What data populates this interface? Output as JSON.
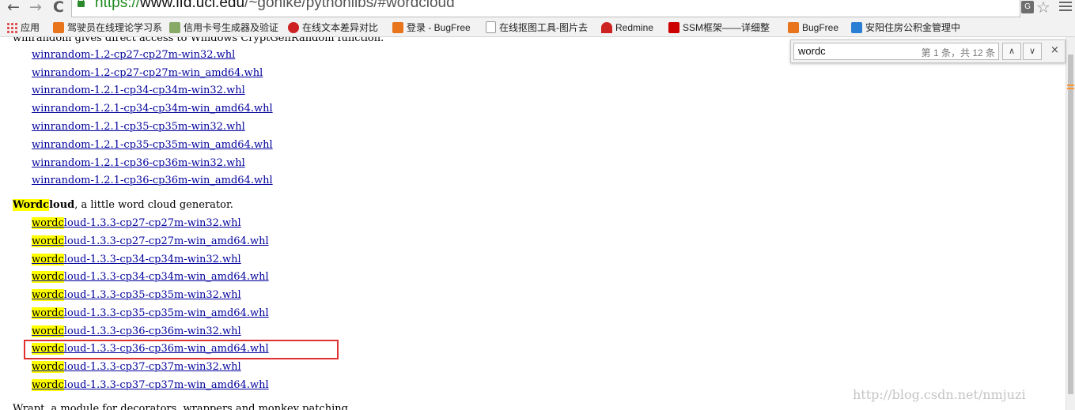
{
  "browser": {
    "url_scheme": "https://",
    "url_host": "www.lfd.uci.edu",
    "url_path": "/~gohlke/pythonlibs/#wordcloud",
    "back_glyph": "←",
    "forward_glyph": "→",
    "reload_glyph": "C",
    "star_glyph": "☆",
    "translate_glyph": "G"
  },
  "bookmarks": [
    {
      "label": "应用",
      "icon": "apps-icon",
      "color": "#d44"
    },
    {
      "label": "驾驶员在线理论学习系",
      "icon": "favicon-icon",
      "color": "#e8741c"
    },
    {
      "label": "信用卡号生成器及验证",
      "icon": "pen-icon",
      "color": "#7a6"
    },
    {
      "label": "在线文本差异对比",
      "icon": "favicon-icon",
      "color": "#c22"
    },
    {
      "label": "登录 - BugFree",
      "icon": "favicon-icon",
      "color": "#e8741c"
    },
    {
      "label": "在线抠图工具-图片去",
      "icon": "page-icon",
      "color": "#999"
    },
    {
      "label": "Redmine",
      "icon": "favicon-icon",
      "color": "#c22"
    },
    {
      "label": "SSM框架——详细整",
      "icon": "favicon-icon",
      "color": "#c00"
    },
    {
      "label": "BugFree",
      "icon": "favicon-icon",
      "color": "#e8741c"
    },
    {
      "label": "安阳住房公积金管理中",
      "icon": "favicon-icon",
      "color": "#2a7fd4"
    }
  ],
  "find": {
    "query": "wordc",
    "count": "第 1 条，共 12 条",
    "prev_glyph": "∧",
    "next_glyph": "∨",
    "close_glyph": "×"
  },
  "page": {
    "cut_line": "winrandom gives direct access to Windows CryptGenRandom function.",
    "winrandom_links": [
      "winrandom‑1.2‑cp27‑cp27m‑win32.whl",
      "winrandom‑1.2‑cp27‑cp27m‑win_amd64.whl",
      "winrandom‑1.2.1‑cp34‑cp34m‑win32.whl",
      "winrandom‑1.2.1‑cp34‑cp34m‑win_amd64.whl",
      "winrandom‑1.2.1‑cp35‑cp35m‑win32.whl",
      "winrandom‑1.2.1‑cp35‑cp35m‑win_amd64.whl",
      "winrandom‑1.2.1‑cp36‑cp36m‑win32.whl",
      "winrandom‑1.2.1‑cp36‑cp36m‑win_amd64.whl"
    ],
    "wordcloud": {
      "name_highlight": "Wordc",
      "name_rest": "loud",
      "description": ", a little word cloud generator.",
      "link_highlight": "wordc",
      "link_rests": [
        "loud‑1.3.3‑cp27‑cp27m‑win32.whl",
        "loud‑1.3.3‑cp27‑cp27m‑win_amd64.whl",
        "loud‑1.3.3‑cp34‑cp34m‑win32.whl",
        "loud‑1.3.3‑cp34‑cp34m‑win_amd64.whl",
        "loud‑1.3.3‑cp35‑cp35m‑win32.whl",
        "loud‑1.3.3‑cp35‑cp35m‑win_amd64.whl",
        "loud‑1.3.3‑cp36‑cp36m‑win32.whl",
        "loud‑1.3.3‑cp36‑cp36m‑win_amd64.whl",
        "loud‑1.3.3‑cp37‑cp37m‑win32.whl",
        "loud‑1.3.3‑cp37‑cp37m‑win_amd64.whl"
      ]
    },
    "next_cut_line": "Wrapt, a module for decorators, wrappers and monkey patching.",
    "watermark": "http://blog.csdn.net/nmjuzi"
  },
  "colors": {
    "link": "#00009c",
    "highlight": "#ffff00",
    "annotation_box": "#e03030"
  }
}
